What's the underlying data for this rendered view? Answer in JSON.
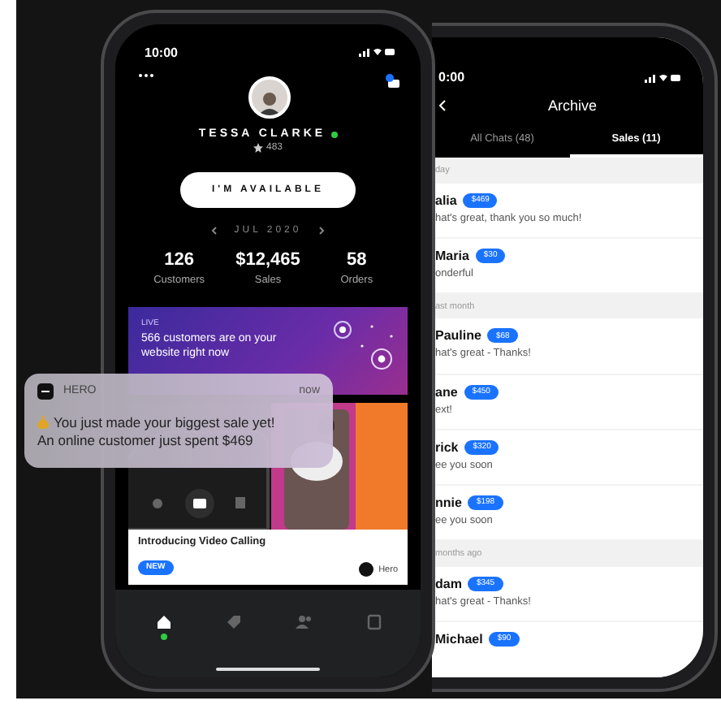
{
  "left_phone": {
    "status_time": "10:00",
    "profile": {
      "name": "TESSA CLARKE",
      "online": true,
      "rating": "483"
    },
    "availability_button": "I'M AVAILABLE",
    "period": "JUL 2020",
    "stats": [
      {
        "value": "126",
        "label": "Customers"
      },
      {
        "value": "$12,465",
        "label": "Sales"
      },
      {
        "value": "58",
        "label": "Orders"
      }
    ],
    "live_banner": {
      "tag": "LIVE",
      "text": "566 customers are on your website right now"
    },
    "promo_card": {
      "title": "Introducing Video Calling",
      "badge": "NEW",
      "brand": "Hero"
    },
    "tab_bar": [
      {
        "kind": "home",
        "selected": true
      },
      {
        "kind": "tag",
        "selected": false
      },
      {
        "kind": "people",
        "selected": false
      },
      {
        "kind": "book",
        "selected": false
      }
    ]
  },
  "right_phone": {
    "status_time": "0:00",
    "title": "Archive",
    "tabs": [
      {
        "label": "All Chats (48)",
        "selected": false
      },
      {
        "label": "Sales (11)",
        "selected": true
      }
    ],
    "chats": [
      {
        "kind": "section",
        "label": "day"
      },
      {
        "kind": "chat",
        "name": "alia",
        "amount": "$469",
        "message": "hat's great, thank you so much!"
      },
      {
        "kind": "chat",
        "name": "Maria",
        "amount": "$30",
        "message": "onderful"
      },
      {
        "kind": "section",
        "label": "ast month"
      },
      {
        "kind": "chat",
        "name": "Pauline",
        "amount": "$68",
        "message": "hat's great - Thanks!"
      },
      {
        "kind": "chat",
        "name": "ane",
        "amount": "$450",
        "message": "ext!"
      },
      {
        "kind": "chat",
        "name": "rick",
        "amount": "$320",
        "message": "ee you soon"
      },
      {
        "kind": "chat",
        "name": "nnie",
        "amount": "$198",
        "message": "ee you soon"
      },
      {
        "kind": "section",
        "label": "months ago"
      },
      {
        "kind": "chat",
        "name": "dam",
        "amount": "$345",
        "message": "hat's great - Thanks!"
      },
      {
        "kind": "chat",
        "name": "Michael",
        "amount": "$90"
      }
    ]
  },
  "notification": {
    "app": "HERO",
    "time": "now",
    "lines": [
      "You just made your biggest sale yet!",
      "An online customer just spent $469"
    ]
  }
}
